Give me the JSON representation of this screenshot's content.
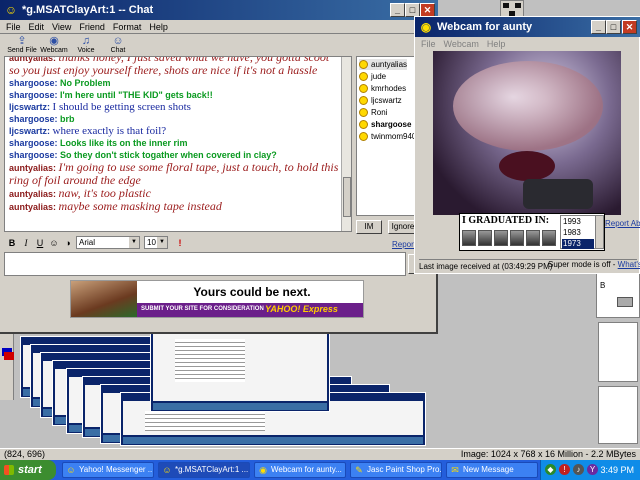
{
  "desktop": {
    "status_left": "(824, 696)",
    "status_right": "Image:  1024 x 768 x 16 Million - 2.2 MBytes",
    "palette_letter": "B"
  },
  "chat": {
    "title": "*g.MSATClayArt:1 -- Chat",
    "menu": [
      "File",
      "Edit",
      "View",
      "Friend",
      "Format",
      "Help"
    ],
    "toolbar": [
      {
        "label": "Send File",
        "icon": "send-file-icon"
      },
      {
        "label": "Webcam",
        "icon": "webcam-icon"
      },
      {
        "label": "Voice",
        "icon": "microphone-icon"
      },
      {
        "label": "Chat",
        "icon": "chat-icon"
      }
    ],
    "messages": [
      {
        "who": "auntyalias:",
        "text": "thanks honey, I just saved what we have, you gotta scoot so you just enjoy yourself there, shots are nice if it's not a hassle",
        "style": "aunty"
      },
      {
        "who": "shargoose:",
        "text": "No Problem",
        "style": "sharg"
      },
      {
        "who": "shargoose:",
        "text": "I'm here until \"THE KID\" gets back!!",
        "style": "sharg"
      },
      {
        "who": "ljcswartz:",
        "text": "I should be getting screen shots",
        "style": "ljc"
      },
      {
        "who": "shargoose:",
        "text": "brb",
        "style": "sharg"
      },
      {
        "who": "ljcswartz:",
        "text": "where exactly is that foil?",
        "style": "ljc"
      },
      {
        "who": "shargoose:",
        "text": "Looks like its on the inner rim",
        "style": "sharg"
      },
      {
        "who": "shargoose:",
        "text": "So they don't stick togather when covered in clay?",
        "style": "sharg"
      },
      {
        "who": "auntyalias:",
        "text": "I'm going to use some floral tape, just a touch, to hold this ring of foil around the edge",
        "style": "aunty"
      },
      {
        "who": "auntyalias:",
        "text": "naw, it's too plastic",
        "style": "aunty"
      },
      {
        "who": "auntyalias:",
        "text": "maybe some masking tape instead",
        "style": "aunty"
      }
    ],
    "users": [
      {
        "name": "auntyalias",
        "bold": false,
        "selected": true
      },
      {
        "name": "jude",
        "bold": false,
        "selected": false
      },
      {
        "name": "kmrhodes",
        "bold": false,
        "selected": false
      },
      {
        "name": "ljcswartz",
        "bold": false,
        "selected": false
      },
      {
        "name": "Roni",
        "bold": false,
        "selected": false
      },
      {
        "name": "shargoose",
        "bold": true,
        "selected": false
      },
      {
        "name": "twinmom94002",
        "bold": false,
        "selected": false
      }
    ],
    "im_label": "IM",
    "ignore_label": "Ignore U",
    "report_label": "Report A",
    "font_name": "Arial",
    "font_size": "10",
    "send_label": "Se",
    "input_value": ""
  },
  "ad": {
    "headline": "Yours could be next.",
    "cta": "SUBMIT YOUR SITE FOR CONSIDERATION",
    "brand": "YAHOO! Express"
  },
  "webcam": {
    "title": "Webcam for aunty",
    "menu": [
      "File",
      "Webcam",
      "Help"
    ],
    "report_abuse": "Report Abus",
    "banner_title": "I GRADUATED IN:",
    "years": [
      "1993",
      "1983",
      "1973"
    ],
    "selected_year": "1973",
    "status": "Last image received at (03:49:29 PM)",
    "super_mode": "Super mode is off - ",
    "super_link": "What's this"
  },
  "taskbar": {
    "start": "start",
    "tasks": [
      {
        "label": "Yahoo! Messenger ...",
        "icon": "yahoo-messenger-icon",
        "active": false
      },
      {
        "label": "*g.MSATClayArt:1 ...",
        "icon": "chat-window-icon",
        "active": true
      },
      {
        "label": "Webcam for aunty...",
        "icon": "webcam-window-icon",
        "active": false
      },
      {
        "label": "Jasc Paint Shop Pro...",
        "icon": "paint-shop-pro-icon",
        "active": false
      },
      {
        "label": "New Message",
        "icon": "new-message-icon",
        "active": false
      }
    ],
    "clock": "3:49 PM"
  },
  "colors": {
    "titlebar": "#0a246a",
    "taskbar": "#245edb",
    "aunty_text": "#9b1c1c",
    "sharg_text": "#0a9a20",
    "ljc_text": "#1a2aa0"
  }
}
